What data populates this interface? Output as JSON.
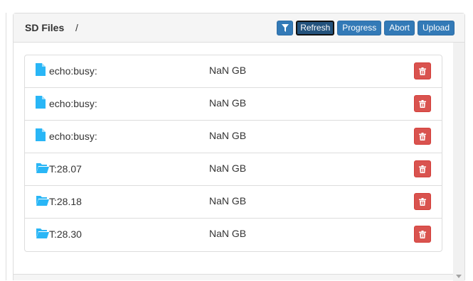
{
  "panel": {
    "title": "SD Files",
    "path": "/"
  },
  "toolbar": {
    "filter_icon": "filter-icon",
    "refresh_label": "Refresh",
    "progress_label": "Progress",
    "abort_label": "Abort",
    "upload_label": "Upload"
  },
  "files": [
    {
      "type": "file",
      "icon": "file-icon",
      "name": "echo:busy:",
      "size": "NaN GB"
    },
    {
      "type": "file",
      "icon": "file-icon",
      "name": "echo:busy:",
      "size": "NaN GB"
    },
    {
      "type": "file",
      "icon": "file-icon",
      "name": "echo:busy:",
      "size": "NaN GB"
    },
    {
      "type": "folder",
      "icon": "folder-open-icon",
      "name": "T:28.07",
      "size": "NaN GB"
    },
    {
      "type": "folder",
      "icon": "folder-open-icon",
      "name": "T:28.18",
      "size": "NaN GB"
    },
    {
      "type": "folder",
      "icon": "folder-open-icon",
      "name": "T:28.30",
      "size": "NaN GB"
    }
  ],
  "colors": {
    "primary": "#337ab7",
    "danger": "#d9534f",
    "icon": "#29b6f6"
  }
}
